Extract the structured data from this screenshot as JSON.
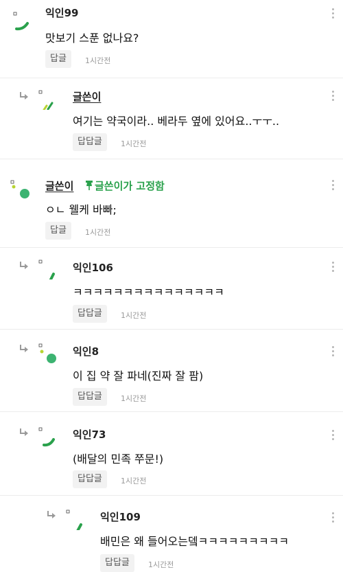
{
  "comments": [
    {
      "author": "익인99",
      "text": "맛보기 스푼 없나요?",
      "reply_label": "답글",
      "time": "1시간전"
    },
    {
      "author": "글쓴이",
      "text": "여기는 약국이라.. 베라두 옆에 있어요..ㅜㅜ..",
      "reply_label": "답답글",
      "time": "1시간전"
    },
    {
      "author": "글쓴이",
      "pinned_label": "글쓴이가 고정함",
      "text": "ㅇㄴ 웰케 바빠;",
      "reply_label": "답글",
      "time": "1시간전"
    },
    {
      "author": "익인106",
      "text": "ㅋㅋㅋㅋㅋㅋㅋㅋㅋㅋㅋㅋㅋㅋㅋ",
      "reply_label": "답답글",
      "time": "1시간전"
    },
    {
      "author": "익인8",
      "text": "이 집 약 잘 파네(진짜 잘 팜)",
      "reply_label": "답답글",
      "time": "1시간전"
    },
    {
      "author": "익인73",
      "text": "(배달의 민족 쭈문!)",
      "reply_label": "답답글",
      "time": "1시간전"
    },
    {
      "author": "익인109",
      "text": "배민은 왜 들어오는뎈ㅋㅋㅋㅋㅋㅋㅋㅋㅋ",
      "reply_label": "답답글",
      "time": "1시간전"
    }
  ],
  "colors": {
    "accent_green": "#2aa14c",
    "avatar_green": "#3cb371"
  }
}
